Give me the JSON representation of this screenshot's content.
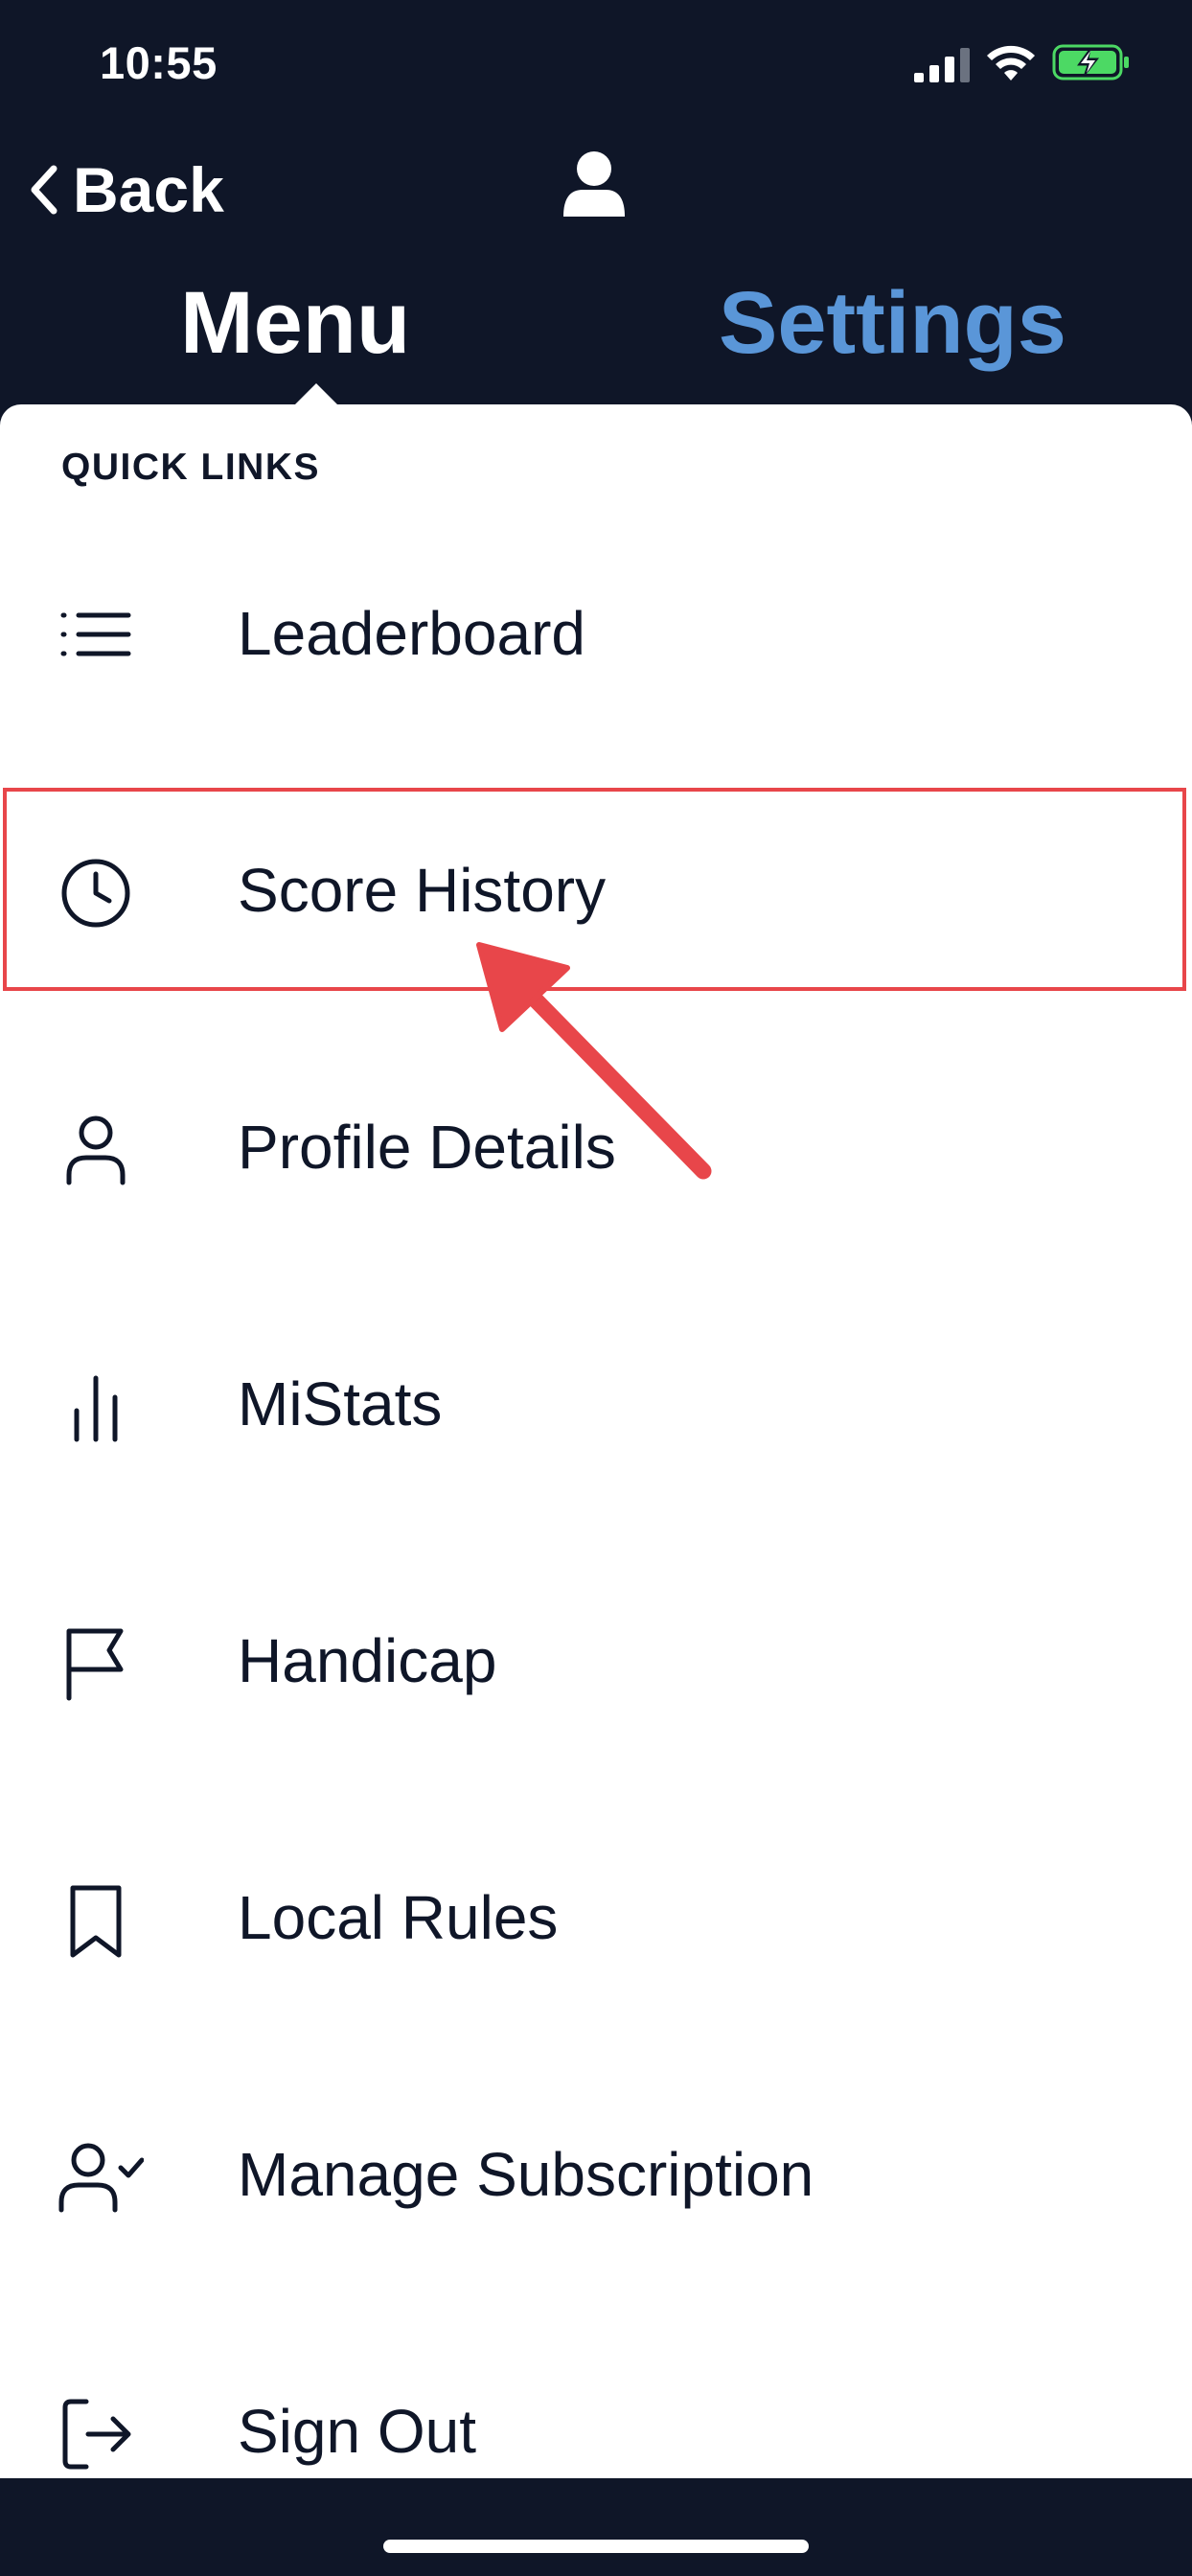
{
  "status_bar": {
    "time": "10:55"
  },
  "header": {
    "back_label": "Back",
    "tabs": [
      {
        "label": "Menu",
        "active": true
      },
      {
        "label": "Settings",
        "active": false
      }
    ]
  },
  "colors": {
    "background": "#0f1628",
    "panel": "#ffffff",
    "active_tab": "#ffffff",
    "inactive_tab": "#5a96d8",
    "highlight": "#e8464a",
    "battery": "#4cd964"
  },
  "quick_links": {
    "title": "QUICK LINKS",
    "items": [
      {
        "label": "Leaderboard",
        "icon": "list-icon"
      },
      {
        "label": "Score History",
        "icon": "clock-icon"
      },
      {
        "label": "Profile Details",
        "icon": "user-icon"
      },
      {
        "label": "MiStats",
        "icon": "bar-chart-icon"
      },
      {
        "label": "Handicap",
        "icon": "flag-icon"
      },
      {
        "label": "Local Rules",
        "icon": "bookmark-icon"
      },
      {
        "label": "Manage Subscription",
        "icon": "user-check-icon"
      },
      {
        "label": "Sign Out",
        "icon": "sign-out-icon"
      }
    ]
  }
}
